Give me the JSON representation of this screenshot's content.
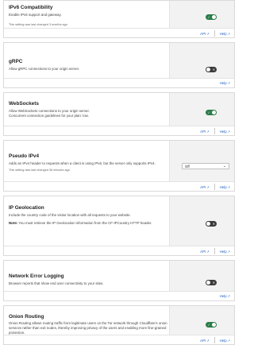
{
  "cards": [
    {
      "title": "IPv6 Compatibility",
      "description": "Enable IPv6 support and gateway.",
      "meta": "This setting was last changed 3 months ago",
      "control": {
        "type": "toggle",
        "state": "on",
        "icon": "check-icon"
      },
      "links": {
        "api": "API",
        "help": "Help"
      }
    },
    {
      "title": "gRPC",
      "description": "Allow gRPC connections to your origin server.",
      "control": {
        "type": "toggle",
        "state": "off",
        "icon": "x-icon"
      },
      "links": {
        "help": "Help"
      }
    },
    {
      "title": "WebSockets",
      "description_lines": [
        "Allow WebSockets connections to your origin server.",
        "Concurrent connection guidelines for your plan: low."
      ],
      "control": {
        "type": "toggle",
        "state": "on",
        "icon": "check-icon"
      },
      "links": {
        "api": "API",
        "help": "Help"
      }
    },
    {
      "title": "Pseudo IPv4",
      "description": "Adds an IPv4 header to requests when a client is using IPv6, but the server only supports IPv4.",
      "meta": "This setting was last changed 36 minutes ago",
      "control": {
        "type": "select",
        "value": "Off"
      },
      "links": {
        "api": "API",
        "help": "Help"
      }
    },
    {
      "title": "IP Geolocation",
      "description": "Include the country code of the visitor location with all requests to your website.",
      "note_label": "Note:",
      "note_text": "You must retrieve the IP Geolocation information from the CF-IPCountry HTTP header.",
      "control": {
        "type": "toggle",
        "state": "off",
        "icon": "x-icon"
      },
      "links": {
        "api": "API",
        "help": "Help"
      }
    },
    {
      "title": "Network Error Logging",
      "description": "Browser reports that show end user connectivity to your sites.",
      "control": {
        "type": "toggle",
        "state": "off",
        "icon": "x-icon"
      },
      "links": {
        "help": "Help"
      }
    },
    {
      "title": "Onion Routing",
      "description": "Onion Routing allows routing traffic from legitimate users on the Tor network through Cloudflare's onion services rather than exit nodes, thereby improving privacy of the users and enabling more fine-grained protection.",
      "control": {
        "type": "toggle",
        "state": "on",
        "icon": "check-icon"
      },
      "links": {
        "api": "API",
        "help": "Help"
      }
    }
  ],
  "symbols": {
    "check": "✓",
    "x": "✕",
    "chevron": "⌄",
    "external": "↗"
  }
}
